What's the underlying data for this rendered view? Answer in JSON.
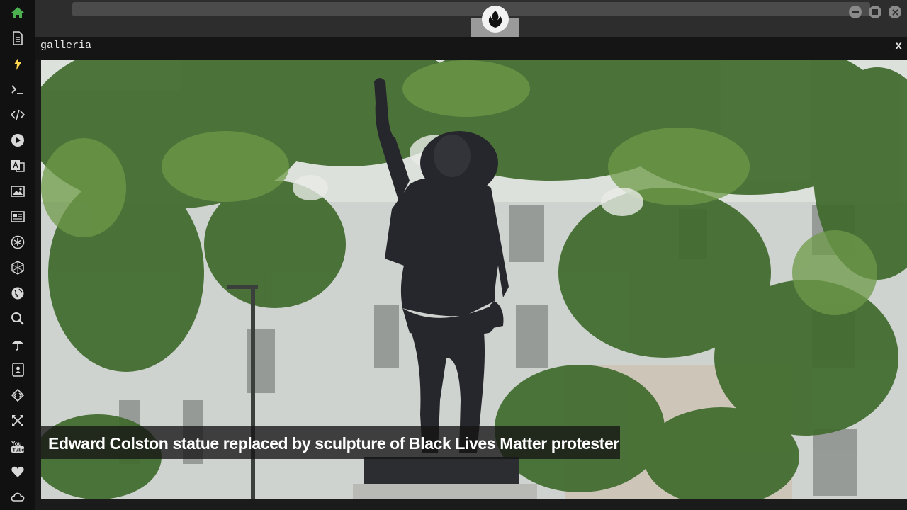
{
  "panel": {
    "title": "galleria",
    "close_label": "x"
  },
  "gallery": {
    "caption": "Edward Colston statue replaced by sculpture of Black Lives Matter protester"
  },
  "sidebar": {
    "items": [
      {
        "icon": "home-icon",
        "color": "#4caf50"
      },
      {
        "icon": "document-icon"
      },
      {
        "icon": "lightning-icon",
        "color": "#ffd54f"
      },
      {
        "icon": "terminal-icon"
      },
      {
        "icon": "code-icon"
      },
      {
        "icon": "play-icon"
      },
      {
        "icon": "translate-icon"
      },
      {
        "icon": "image-icon"
      },
      {
        "icon": "newspaper-icon"
      },
      {
        "icon": "asterisk-icon"
      },
      {
        "icon": "hexagon-icon"
      },
      {
        "icon": "globe-icon"
      },
      {
        "icon": "search-icon"
      },
      {
        "icon": "umbrella-icon"
      },
      {
        "icon": "contact-card-icon"
      },
      {
        "icon": "code-diamond-icon"
      },
      {
        "icon": "expand-icon"
      },
      {
        "icon": "youtube-icon"
      },
      {
        "icon": "heart-icon"
      },
      {
        "icon": "cloud-icon"
      }
    ]
  },
  "colors": {
    "sidebar_bg": "#111111",
    "topbar_bg": "#2d2d2d",
    "icon": "#d8d8d8",
    "accent_home": "#4caf50",
    "accent_bolt": "#ffd54f"
  }
}
